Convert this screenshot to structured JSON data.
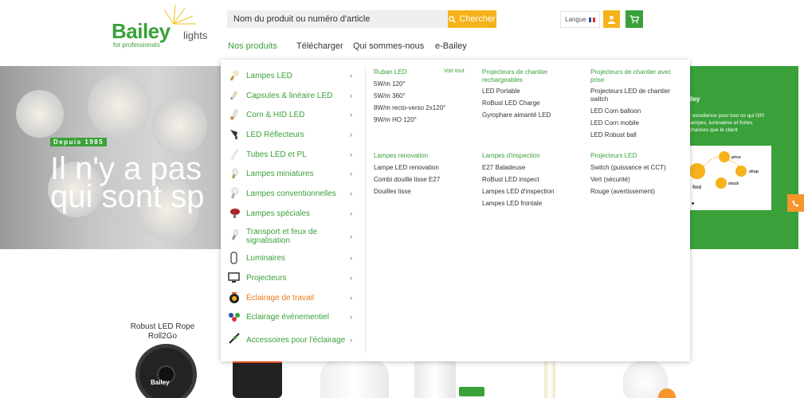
{
  "header": {
    "logo": {
      "brand": "Bailey",
      "sub": "lights",
      "tagline": "for professionals"
    },
    "search": {
      "placeholder": "Nom du produit ou numéro d'article",
      "button_label": "Chercher"
    },
    "language_label": "Langue",
    "nav": [
      "Nos produits",
      "Télécharger",
      "Qui sommes-nous",
      "e-Bailey"
    ]
  },
  "hero": {
    "since_badge": "Depuis 1985",
    "line1": "Il n'y a pas",
    "line2": "qui sont sp",
    "right_title": "iley",
    "right_text": "r excellence pour tout ce qui 000 lampes, luminaires et fortes chances que le client",
    "infographic": {
      "labels": [
        "find",
        "price",
        "shop",
        "stock"
      ]
    }
  },
  "menu": {
    "categories": [
      {
        "label": "Lampes LED",
        "icon": "led-bulb-icon"
      },
      {
        "label": "Capsules & linéaire LED",
        "icon": "capsule-lamp-icon"
      },
      {
        "label": "Corn & HID LED",
        "icon": "corn-lamp-icon"
      },
      {
        "label": "LED Réflecteurs",
        "icon": "reflector-lamp-icon"
      },
      {
        "label": "Tubes LED et PL",
        "icon": "led-tube-icon"
      },
      {
        "label": "Lampes miniatures",
        "icon": "miniature-lamp-icon"
      },
      {
        "label": "Lampes conventionnelles",
        "icon": "conventional-lamp-icon"
      },
      {
        "label": "Lampes spéciales",
        "icon": "special-lamp-icon"
      },
      {
        "label": "Transport et feux de signalisation",
        "icon": "transport-lamp-icon"
      },
      {
        "label": "Luminaires",
        "icon": "luminaire-icon"
      },
      {
        "label": "Projecteurs",
        "icon": "floodlight-icon"
      },
      {
        "label": "Éclairage de travail",
        "icon": "work-light-icon"
      },
      {
        "label": "Eclairage événementiel",
        "icon": "event-lighting-icon"
      },
      {
        "label": "Accessoires pour l'éclairage",
        "icon": "accessories-icon"
      }
    ],
    "see_all": "Voir tout",
    "columns": [
      {
        "title": "Ruban LED",
        "links": [
          "5W/m 120°",
          "5W/m 360°",
          "8W/m recto-verso 2x120°",
          "9W/m HO 120°"
        ]
      },
      {
        "title": "Projecteurs de chantier rechargeables",
        "links": [
          "LED Portable",
          "RoBust LED Charge",
          "Gyrophare aimanté LED"
        ]
      },
      {
        "title": "Projecteurs de chantier avec prise",
        "links": [
          "Projecteurs LED de chantier switch",
          "LED Corn balloon",
          "LED Corn mobile",
          "LED Robust ball"
        ]
      },
      {
        "title": "Lampes renovation",
        "links": [
          "Lampe LED renovation",
          "Combi douille lisse E27",
          "Douilles lisse"
        ]
      },
      {
        "title": "Lampes d'inspection",
        "links": [
          "E27 Baladeuse",
          "RoBust LED inspect",
          "Lampes LED d'inspection",
          "Lampes LED frontale"
        ]
      },
      {
        "title": "Projecteurs LED",
        "links": [
          "Switch (puissance et CCT)",
          "Vert (sécurité)",
          "Rouge (avertissement)"
        ]
      }
    ]
  },
  "products": {
    "featured_title": "Robust LED Rope Roll2Go",
    "reel_logo": "Bailey"
  },
  "colors": {
    "green": "#3aa13a",
    "orange": "#f6b21a",
    "accent_orange": "#e97a1e"
  }
}
